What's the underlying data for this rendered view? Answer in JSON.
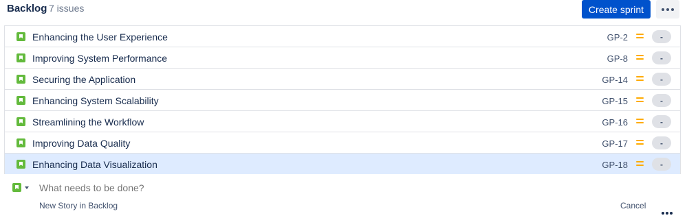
{
  "backlog": {
    "title": "Backlog",
    "issue_count": "7 issues",
    "create_sprint_label": "Create sprint"
  },
  "issues": [
    {
      "summary": "Enhancing the User Experience",
      "key": "GP-2",
      "estimate": "-",
      "selected": false
    },
    {
      "summary": "Improving System Performance",
      "key": "GP-8",
      "estimate": "-",
      "selected": false
    },
    {
      "summary": "Securing the Application",
      "key": "GP-14",
      "estimate": "-",
      "selected": false
    },
    {
      "summary": "Enhancing System Scalability",
      "key": "GP-15",
      "estimate": "-",
      "selected": false
    },
    {
      "summary": "Streamlining the Workflow",
      "key": "GP-16",
      "estimate": "-",
      "selected": false
    },
    {
      "summary": "Improving Data Quality",
      "key": "GP-17",
      "estimate": "-",
      "selected": false
    },
    {
      "summary": "Enhancing Data Visualization",
      "key": "GP-18",
      "estimate": "-",
      "selected": true
    }
  ],
  "create_issue": {
    "placeholder": "What needs to be done?",
    "helper": "New Story in Backlog",
    "cancel_label": "Cancel"
  },
  "colors": {
    "primary": "#0052cc",
    "story": "#63ba3c",
    "priority_medium": "#ffab00",
    "selected_row": "#deebff"
  },
  "icons": {
    "issue_type": "story-icon",
    "priority": "priority-medium-icon",
    "more": "more-icon"
  }
}
